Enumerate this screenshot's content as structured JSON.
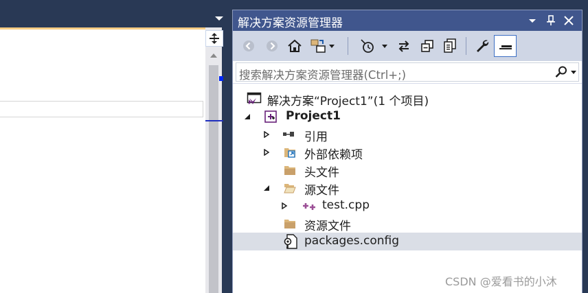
{
  "app": {
    "accent": "#40568d",
    "background": "#293955"
  },
  "panel": {
    "title": "解决方案资源管理器",
    "title_icons": [
      "dropdown-icon",
      "pin-icon",
      "close-icon"
    ]
  },
  "toolbar": {
    "buttons": [
      "back-icon",
      "forward-icon",
      "home-icon",
      "switch-views-icon",
      "pending-changes-icon",
      "sync-icon",
      "collapse-all-icon",
      "show-all-files-icon",
      "properties-icon",
      "preview-icon"
    ]
  },
  "search": {
    "placeholder": "搜索解决方案资源管理器(Ctrl+;)"
  },
  "tree": {
    "solution": "解决方案“Project1”(1 个项目)",
    "project": "Project1",
    "references": "引用",
    "external_deps": "外部依赖项",
    "header_files": "头文件",
    "source_files": "源文件",
    "test_cpp": "test.cpp",
    "resource_files": "资源文件",
    "packages_config": "packages.config"
  },
  "watermark": "CSDN @爱看书的小沐"
}
